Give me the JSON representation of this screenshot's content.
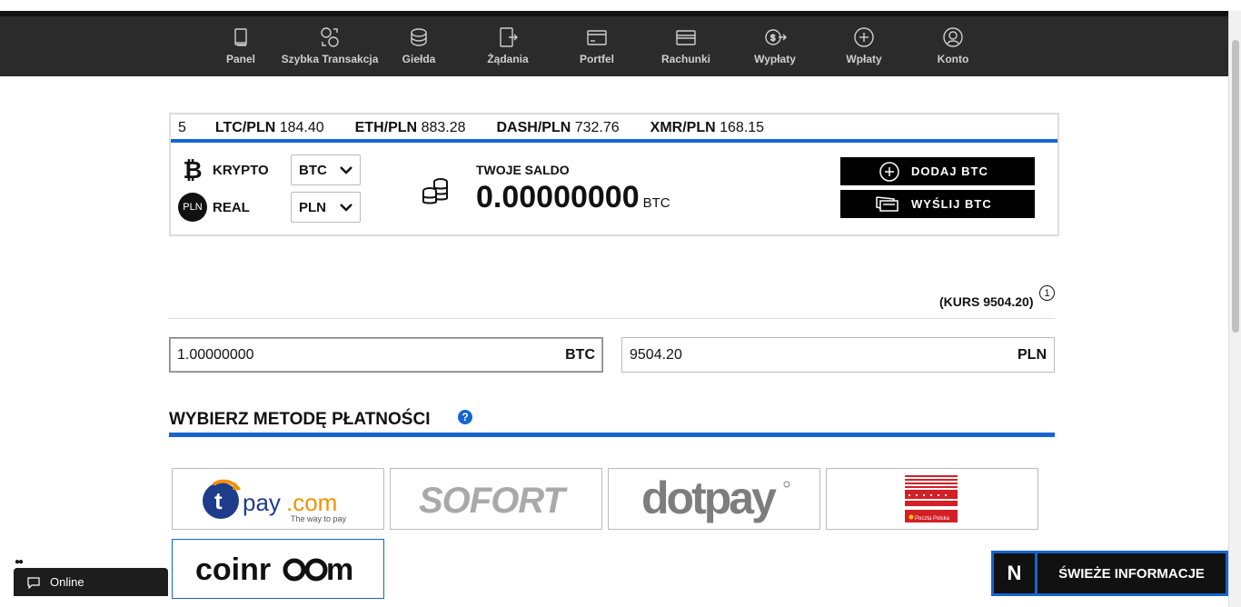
{
  "nav": [
    {
      "label": "Panel",
      "icon": "book-icon"
    },
    {
      "label": "Szybka Transakcja",
      "icon": "exchange-icon"
    },
    {
      "label": "Giełda",
      "icon": "coins-stack-icon"
    },
    {
      "label": "Żądania",
      "icon": "request-icon"
    },
    {
      "label": "Portfel",
      "icon": "wallet-icon"
    },
    {
      "label": "Rachunki",
      "icon": "card-icon"
    },
    {
      "label": "Wypłaty",
      "icon": "withdraw-icon"
    },
    {
      "label": "Wpłaty",
      "icon": "plus-circle-icon"
    },
    {
      "label": "Konto",
      "icon": "user-icon"
    }
  ],
  "ticker": [
    {
      "pair": "",
      "price": "5"
    },
    {
      "pair": "LTC/PLN",
      "price": "184.40"
    },
    {
      "pair": "ETH/PLN",
      "price": "883.28"
    },
    {
      "pair": "DASH/PLN",
      "price": "732.76"
    },
    {
      "pair": "XMR/PLN",
      "price": "168.15"
    }
  ],
  "wallet": {
    "krypto_label": "KRYPTO",
    "krypto_value": "BTC",
    "real_label": "REAL",
    "real_badge": "PLN",
    "real_value": "PLN",
    "saldo_label": "TWOJE SALDO",
    "saldo_value": "0.00000000",
    "saldo_unit": "BTC",
    "add_button": "DODAJ BTC",
    "send_button": "WYŚLIJ BTC"
  },
  "rate": {
    "text": "(KURS 9504.20)",
    "info": "1"
  },
  "amount_btc": {
    "value": "1.00000000",
    "unit": "BTC"
  },
  "amount_pln": {
    "value": "9504.20",
    "unit": "PLN"
  },
  "payment": {
    "title": "WYBIERZ METODĘ PŁATNOŚCI",
    "help": "?",
    "methods": [
      {
        "name": "tpay.com",
        "tagline": "The way to pay"
      },
      {
        "name": "SOFORT"
      },
      {
        "name": "dotpay"
      },
      {
        "name": "Pocztex",
        "caption": "Poczta Polska"
      },
      {
        "name": "coinroom"
      }
    ]
  },
  "chat": {
    "label": "Online"
  },
  "news": {
    "logo": "N",
    "label": "ŚWIEŻE INFORMACJE"
  },
  "colors": {
    "accent": "#1565d0",
    "topbar": "#2b2b2b",
    "tpay_orange": "#f39200",
    "tpay_blue": "#1f3c8a",
    "poczta_red": "#d32027"
  }
}
